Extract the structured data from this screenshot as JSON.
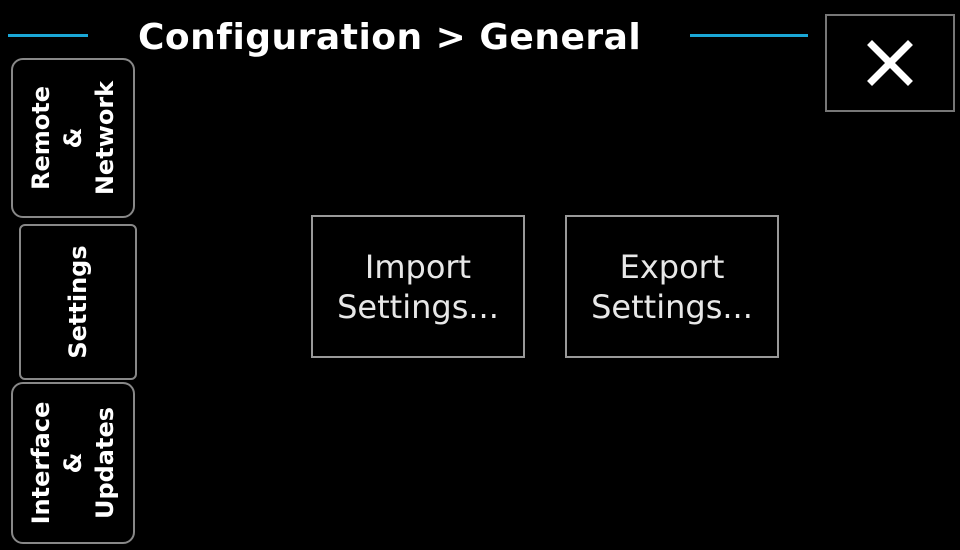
{
  "header": {
    "breadcrumb": "Configuration > General",
    "accent_color": "#1aa7d6"
  },
  "close_button": {
    "icon": "close-icon",
    "label": "×"
  },
  "tabs": [
    {
      "id": "remote-network",
      "lines": [
        "Remote",
        "&",
        "Network"
      ],
      "active": false
    },
    {
      "id": "settings",
      "lines": [
        "Settings"
      ],
      "active": true
    },
    {
      "id": "interface-updates",
      "lines": [
        "Interface",
        "&",
        "Updates"
      ],
      "active": false
    }
  ],
  "actions": {
    "import": {
      "line1": "Import",
      "line2": "Settings..."
    },
    "export": {
      "line1": "Export",
      "line2": "Settings..."
    }
  }
}
